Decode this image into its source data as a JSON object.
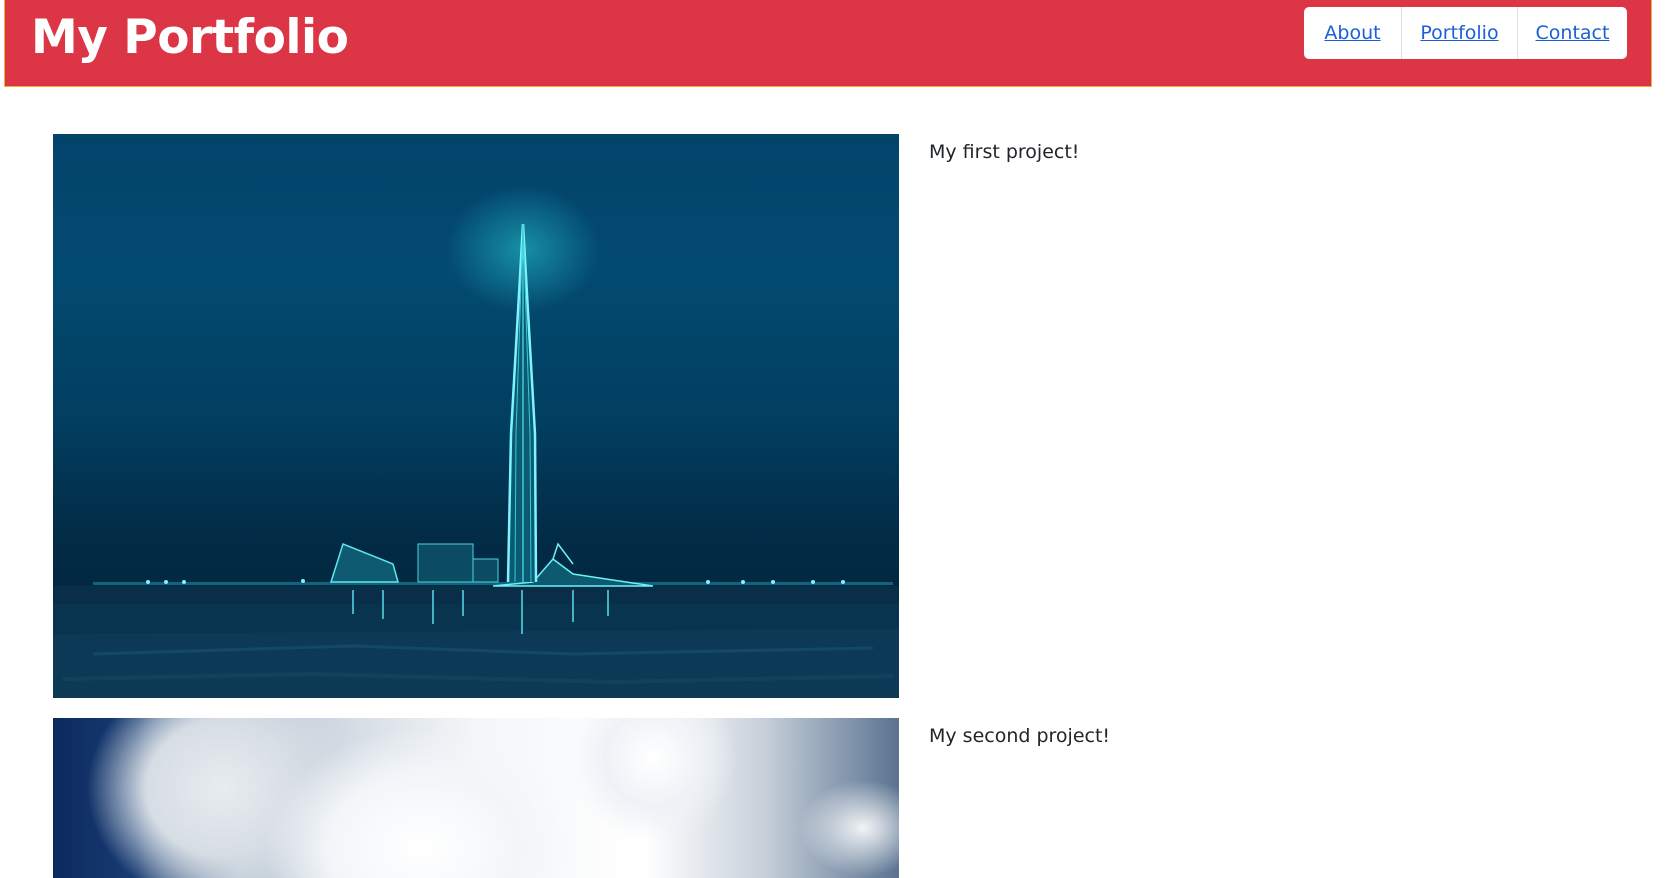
{
  "header": {
    "title": "My Portfolio",
    "nav": [
      {
        "label": "About"
      },
      {
        "label": "Portfolio"
      },
      {
        "label": "Contact"
      }
    ]
  },
  "projects": [
    {
      "caption": "My first project!",
      "image": "night-tower-photo"
    },
    {
      "caption": "My second project!",
      "image": "cloud-smoke-photo"
    }
  ],
  "colors": {
    "header_bg": "#dc3545",
    "link": "#1a5fd6",
    "text": "#212529"
  }
}
